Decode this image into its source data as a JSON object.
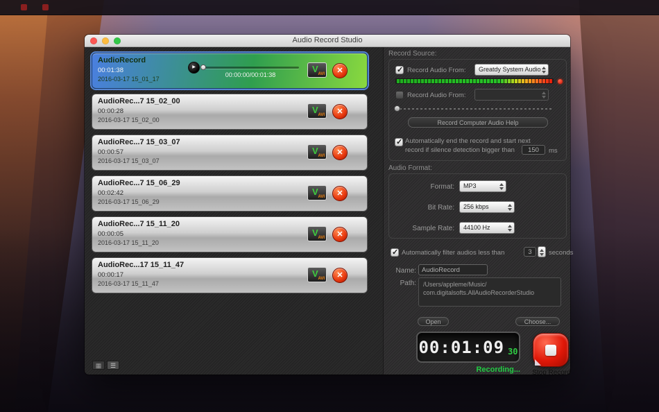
{
  "window_title": "Audio Record Studio",
  "recordings": [
    {
      "name": "AudioRecord",
      "duration": "00:01:38",
      "date": "2016-03-17 15_01_17",
      "selected": true,
      "player_time": "00:00:00/00:01:38"
    },
    {
      "name": "AudioRec...7 15_02_00",
      "duration": "00:00:28",
      "date": "2016-03-17 15_02_00"
    },
    {
      "name": "AudioRec...7 15_03_07",
      "duration": "00:00:57",
      "date": "2016-03-17 15_03_07"
    },
    {
      "name": "AudioRec...7 15_06_29",
      "duration": "00:02:42",
      "date": "2016-03-17 15_06_29"
    },
    {
      "name": "AudioRec...7 15_11_20",
      "duration": "00:00:05",
      "date": "2016-03-17 15_11_20"
    },
    {
      "name": "AudioRec...17 15_11_47",
      "duration": "00:00:17",
      "date": "2016-03-17 15_11_47"
    }
  ],
  "source": {
    "section_label": "Record Source:",
    "from_label": "Record Audio From:",
    "device": "Greatdy System Audio",
    "device2": "",
    "help_button": "Record Computer Audio Help",
    "autoend_line1": "Automatically end the record and start next",
    "autoend_line2": "record if silence detection bigger than",
    "silence_ms": "150",
    "ms_unit": "ms"
  },
  "format": {
    "section_label": "Audio Format:",
    "format_label": "Format:",
    "format_value": "MP3",
    "bitrate_label": "Bit Rate:",
    "bitrate_value": "256 kbps",
    "samplerate_label": "Sample Rate:",
    "samplerate_value": "44100 Hz"
  },
  "filter": {
    "label": "Automatically filter audios less than",
    "value": "3",
    "unit": "seconds"
  },
  "output": {
    "name_label": "Name:",
    "name_value": "AudioRecord",
    "path_label": "Path:",
    "path_line1": "/Users/appleme/Music/",
    "path_line2": "com.digitalsofts.AllAudioRecorderStudio",
    "open_button": "Open",
    "choose_button": "Choose..."
  },
  "timer": {
    "time": "00:01:09",
    "frames": "30",
    "status": "Recording...",
    "stop_label": "Stop Record"
  },
  "icons": {
    "play": "▶",
    "delete": "✕",
    "grid": "▦",
    "list": "☰",
    "file_v": "V",
    "file_avi": "AVI"
  }
}
